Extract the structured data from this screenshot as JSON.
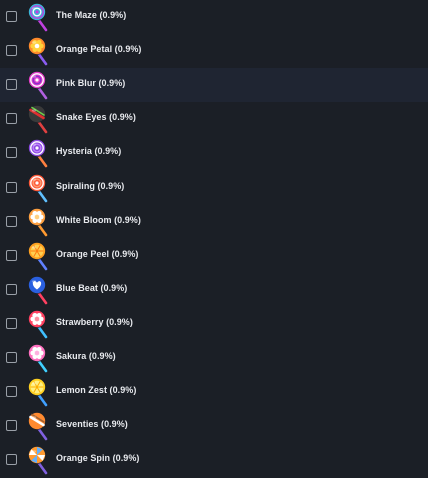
{
  "items": [
    {
      "label": "The Maze (0.9%)",
      "icon": "lollipop-maze-icon",
      "colors": [
        "#3bb6d8",
        "#c040e0",
        "#ffffff"
      ],
      "stick": "#c040e0",
      "pattern": "swirl"
    },
    {
      "label": "Orange Petal (0.9%)",
      "icon": "lollipop-orange-petal-icon",
      "colors": [
        "#ff8a2a",
        "#ffd23a",
        "#ffffff"
      ],
      "stick": "#8a5cf0",
      "pattern": "flower"
    },
    {
      "label": "Pink Blur (0.9%)",
      "icon": "lollipop-pink-blur-icon",
      "colors": [
        "#e040c8",
        "#ffffff",
        "#8a2ad0"
      ],
      "stick": "#b060e0",
      "pattern": "spiral"
    },
    {
      "label": "Snake Eyes (0.9%)",
      "icon": "lollipop-snake-eyes-icon",
      "colors": [
        "#3a3a3a",
        "#e03030",
        "#6fd04a"
      ],
      "stick": "#e04040",
      "pattern": "stripe"
    },
    {
      "label": "Hysteria (0.9%)",
      "icon": "lollipop-hysteria-icon",
      "colors": [
        "#8a4ae0",
        "#ffffff",
        "#c080ff"
      ],
      "stick": "#ff8040",
      "pattern": "swirl"
    },
    {
      "label": "Spiraling (0.9%)",
      "icon": "lollipop-spiraling-icon",
      "colors": [
        "#ff5a3a",
        "#ffffff",
        "#ff9a70"
      ],
      "stick": "#60c0ff",
      "pattern": "spiral"
    },
    {
      "label": "White Bloom (0.9%)",
      "icon": "lollipop-white-bloom-icon",
      "colors": [
        "#ffa040",
        "#ffffff",
        "#ffd080"
      ],
      "stick": "#ff9a30",
      "pattern": "flower"
    },
    {
      "label": "Orange Peel (0.9%)",
      "icon": "lollipop-orange-peel-icon",
      "colors": [
        "#ffa020",
        "#ffcf50",
        "#ff7a10"
      ],
      "stick": "#6080ff",
      "pattern": "citrus"
    },
    {
      "label": "Blue Beat (0.9%)",
      "icon": "lollipop-blue-beat-icon",
      "colors": [
        "#2a60e0",
        "#ffffff",
        "#60b0ff"
      ],
      "stick": "#ff4060",
      "pattern": "heart"
    },
    {
      "label": "Strawberry (0.9%)",
      "icon": "lollipop-strawberry-icon",
      "colors": [
        "#ff4060",
        "#ffffff",
        "#ff90a0"
      ],
      "stick": "#40c0ff",
      "pattern": "flower"
    },
    {
      "label": "Sakura (0.9%)",
      "icon": "lollipop-sakura-icon",
      "colors": [
        "#ff70c0",
        "#ffffff",
        "#ffb0e0"
      ],
      "stick": "#40d0ff",
      "pattern": "flower"
    },
    {
      "label": "Lemon Zest (0.9%)",
      "icon": "lollipop-lemon-zest-icon",
      "colors": [
        "#ffd020",
        "#fff080",
        "#ffb000"
      ],
      "stick": "#40a0ff",
      "pattern": "citrus"
    },
    {
      "label": "Seventies (0.9%)",
      "icon": "lollipop-seventies-icon",
      "colors": [
        "#ff8a30",
        "#ffffff",
        "#a06030"
      ],
      "stick": "#8060e0",
      "pattern": "stripe"
    },
    {
      "label": "Orange Spin (0.9%)",
      "icon": "lollipop-orange-spin-icon",
      "colors": [
        "#ff9a30",
        "#60b0ff",
        "#ffffff"
      ],
      "stick": "#8060e0",
      "pattern": "pinwheel"
    }
  ],
  "highlighted_index": 2,
  "background": "#1b1f26",
  "row_highlight": "#1f2532",
  "text_color": "#e8eaee"
}
